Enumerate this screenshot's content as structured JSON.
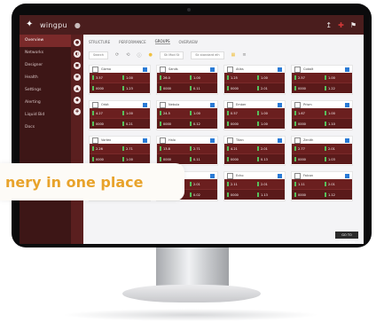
{
  "app": {
    "name": "wingpu"
  },
  "banner": {
    "text": "nery in one place"
  },
  "sidebar": {
    "items": [
      {
        "label": "Overview",
        "active": true
      },
      {
        "label": "Networks",
        "active": false
      },
      {
        "label": "Designer",
        "active": false
      },
      {
        "label": "Health",
        "active": false
      },
      {
        "label": "Settings",
        "active": false
      },
      {
        "label": "Alerting",
        "active": false
      },
      {
        "label": "Liquid Bid",
        "active": false
      },
      {
        "label": "Docs",
        "active": false
      }
    ]
  },
  "tabs": [
    {
      "label": "STRUCTURE"
    },
    {
      "label": "PERFORMANCE"
    },
    {
      "label": "GROUPS",
      "active": true
    },
    {
      "label": "OVERVIEW"
    }
  ],
  "filters": {
    "search_placeholder": "Search",
    "metric": "Sk Mod St",
    "sort": "Sk standard elh"
  },
  "grid": [
    {
      "title": "Gizmo",
      "r1": [
        "3.57",
        "1.00"
      ],
      "r2": [
        "0000",
        "1.23"
      ]
    },
    {
      "title": "Sands",
      "r1": [
        "26.0",
        "1.00"
      ],
      "r2": [
        "0000",
        "0.11"
      ]
    },
    {
      "title": "Atlas",
      "r1": [
        "1.25",
        "1.00"
      ],
      "r2": [
        "0000",
        "2.01"
      ]
    },
    {
      "title": "Cobalt",
      "r1": [
        "2.57",
        "1.00"
      ],
      "r2": [
        "0000",
        "1.22"
      ]
    },
    {
      "title": "Orbit",
      "r1": [
        "4.27",
        "1.00"
      ],
      "r2": [
        "0000",
        "0.21"
      ]
    },
    {
      "title": "Nebula",
      "r1": [
        "24.5",
        "1.00"
      ],
      "r2": [
        "0000",
        "0.12"
      ]
    },
    {
      "title": "Ember",
      "r1": [
        "0.57",
        "1.00"
      ],
      "r2": [
        "0000",
        "1.00"
      ]
    },
    {
      "title": "Prism",
      "r1": [
        "1.67",
        "1.00"
      ],
      "r2": [
        "0000",
        "1.10"
      ]
    },
    {
      "title": "Vortex",
      "r1": [
        "2.26",
        "2.71"
      ],
      "r2": [
        "0000",
        "1.00"
      ]
    },
    {
      "title": "Halo",
      "r1": [
        "13.8",
        "2.71"
      ],
      "r2": [
        "0000",
        "0.11"
      ]
    },
    {
      "title": "Titan",
      "r1": [
        "4.21",
        "2.01"
      ],
      "r2": [
        "0000",
        "0.13"
      ]
    },
    {
      "title": "Zenith",
      "r1": [
        "2.77",
        "2.01"
      ],
      "r2": [
        "0000",
        "1.03"
      ]
    },
    {
      "title": "Pulse",
      "r1": [
        "0.11",
        "2.01"
      ],
      "r2": [
        "0000",
        "1.01"
      ]
    },
    {
      "title": "Quartz",
      "r1": [
        "21.1",
        "2.01"
      ],
      "r2": [
        "0000",
        "0.02"
      ]
    },
    {
      "title": "Echo",
      "r1": [
        "2.11",
        "2.01"
      ],
      "r2": [
        "0000",
        "1.13"
      ]
    },
    {
      "title": "Falcon",
      "r1": [
        "1.11",
        "2.01"
      ],
      "r2": [
        "0000",
        "1.12"
      ]
    }
  ],
  "footer_button": "GO TO OVERVIEW",
  "colors": {
    "brand": "#6b1f1f",
    "banner_text": "#e8a32b"
  }
}
